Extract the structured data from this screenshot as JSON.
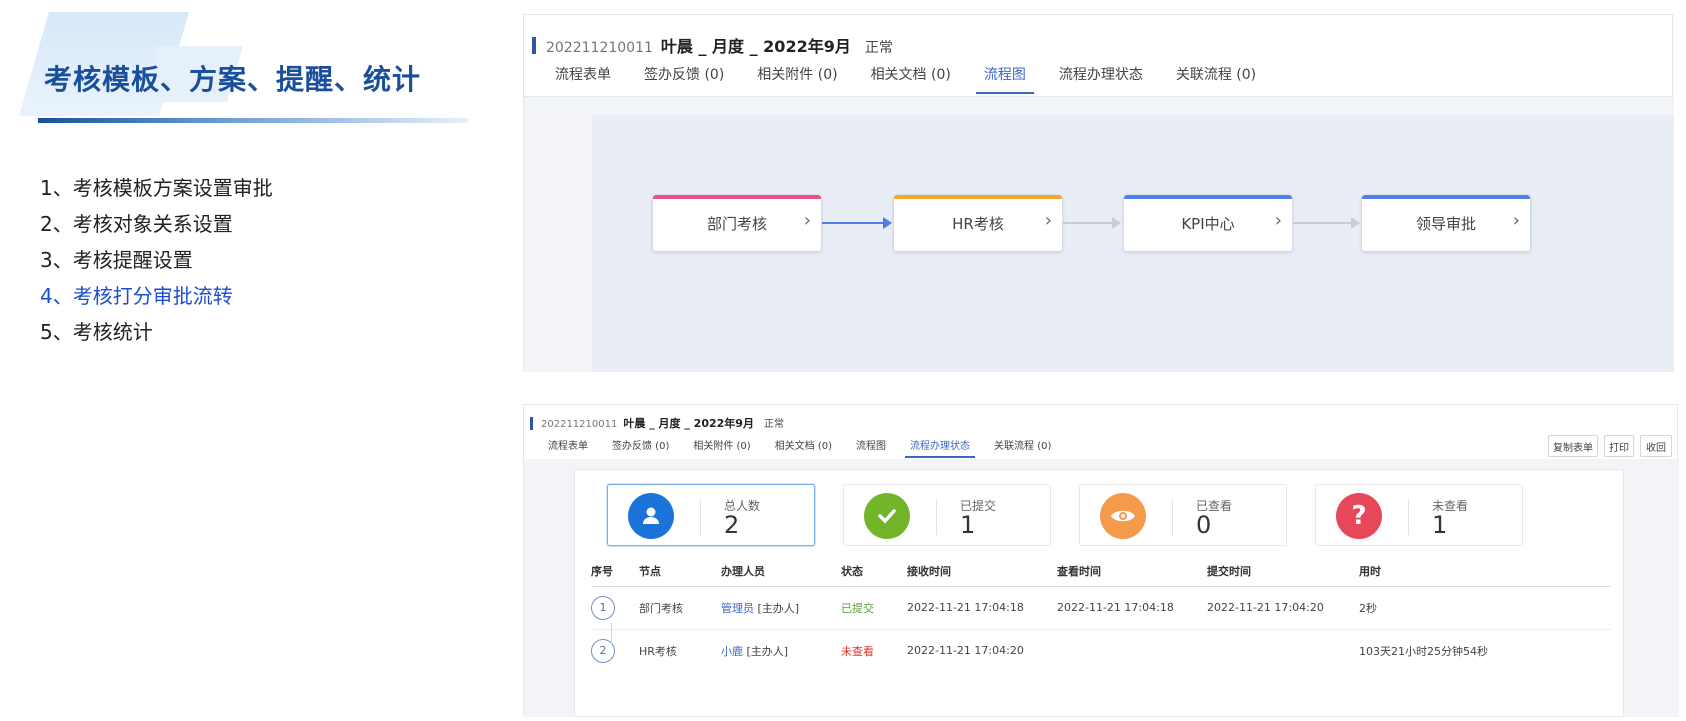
{
  "slide": {
    "title": "考核模板、方案、提醒、统计",
    "menu": [
      "1、考核模板方案设置审批",
      "2、考核对象关系设置",
      "3、考核提醒设置",
      "4、考核打分审批流转",
      "5、考核统计"
    ],
    "active_index": 3,
    "accent": "#1d4ecf"
  },
  "top_panel": {
    "doc_id": "202211210011",
    "doc_title": "叶晨 _ 月度 _ 2022年9月",
    "status": "正常",
    "tabs": [
      "流程表单",
      "签办反馈 (0)",
      "相关附件  (0)",
      "相关文档  (0)",
      "流程图",
      "流程办理状态",
      "关联流程 (0)"
    ],
    "active_tab": "流程图",
    "flow": [
      {
        "label": "部门考核",
        "color": "#e8508a"
      },
      {
        "label": "HR考核",
        "color": "#f5a623"
      },
      {
        "label": "KPI中心",
        "color": "#4f7ee8"
      },
      {
        "label": "领导审批",
        "color": "#4f7ee8"
      }
    ]
  },
  "bottom_panel": {
    "doc_id": "202211210011",
    "doc_title": "叶晨 _ 月度 _ 2022年9月",
    "status": "正常",
    "tabs": [
      "流程表单",
      "签办反馈  (0)",
      "相关附件  (0)",
      "相关文档  (0)",
      "流程图",
      "流程办理状态",
      "关联流程  (0)"
    ],
    "active_tab": "流程办理状态",
    "buttons": [
      "复制表单",
      "打印",
      "收回"
    ],
    "stats": [
      {
        "label": "总人数",
        "value": "2",
        "icon": "user-icon",
        "color": "#1a73d9"
      },
      {
        "label": "已提交",
        "value": "1",
        "icon": "check-icon",
        "color": "#72b52a"
      },
      {
        "label": "已查看",
        "value": "0",
        "icon": "eye-icon",
        "color": "#f59a4a"
      },
      {
        "label": "未查看",
        "value": "1",
        "icon": "question-icon",
        "color": "#e8475a"
      }
    ],
    "table": {
      "headers": [
        "序号",
        "节点",
        "办理人员",
        "状态",
        "接收时间",
        "查看时间",
        "提交时间",
        "用时"
      ],
      "rows": [
        {
          "no": "1",
          "node": "部门考核",
          "person": "管理员",
          "role": "[主办人]",
          "status": "已提交",
          "recv": "2022-11-21 17:04:18",
          "view": "2022-11-21 17:04:18",
          "submit": "2022-11-21 17:04:20",
          "dur": "2秒"
        },
        {
          "no": "2",
          "node": "HR考核",
          "person": "小鹿",
          "role": "[主办人]",
          "status": "未查看",
          "recv": "2022-11-21 17:04:20",
          "view": "",
          "submit": "",
          "dur": "103天21小时25分钟54秒"
        }
      ]
    }
  }
}
